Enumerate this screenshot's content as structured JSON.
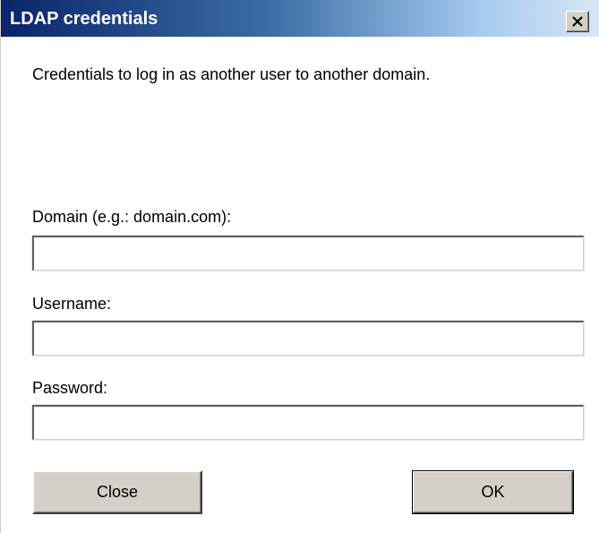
{
  "window": {
    "title": "LDAP credentials",
    "close_icon": "close-icon"
  },
  "description": "Credentials to log in as another user to another domain.",
  "form": {
    "domain": {
      "label": "Domain (e.g.: domain.com):",
      "value": ""
    },
    "username": {
      "label": "Username:",
      "value": ""
    },
    "password": {
      "label": "Password:",
      "value": ""
    }
  },
  "buttons": {
    "close_label": "Close",
    "ok_label": "OK"
  },
  "colors": {
    "title_gradient_start": "#0a246a",
    "title_gradient_end": "#d8e6f4",
    "button_face": "#d4d0c8"
  }
}
